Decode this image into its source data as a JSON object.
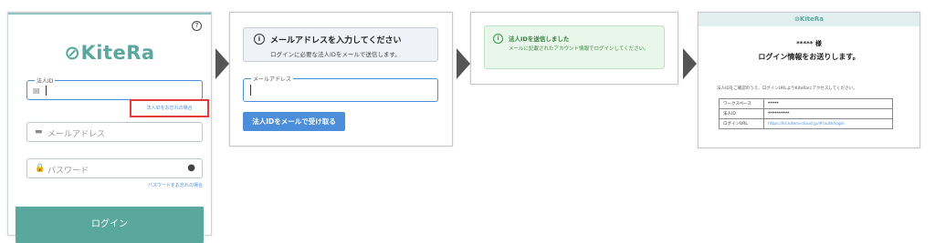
{
  "login": {
    "logo": "KiteRa",
    "help_icon": "?",
    "corporate_id_legend": "法人ID",
    "forgot_corporate_id": "法人IDをお忘れの場合",
    "email_placeholder": "メールアドレス",
    "password_placeholder": "パスワード",
    "forgot_password": "パスワードをお忘れの場合",
    "login_button": "ログイン"
  },
  "request": {
    "info_title": "メールアドレスを入力してください",
    "info_body": "ログインに必要な法人IDをメールで送信します。",
    "email_legend": "メールアドレス",
    "send_button": "法人IDをメールで受け取る"
  },
  "result": {
    "success_title": "法人IDを送信しました",
    "success_body": "メールに記載されたアカウント情報でログインしてください。"
  },
  "email": {
    "header": "KiteRa",
    "recipient": "***** 様",
    "title": "ログイン情報をお送りします。",
    "note": "法人IDをご確認のうえ、ログインURLよりKiteRaにアクセスしてください。",
    "rows": [
      {
        "label": "ワークスペース",
        "value": "*****"
      },
      {
        "label": "法人ID",
        "value": "**********"
      },
      {
        "label": "ログインURL",
        "value": "https://kt.kitera-cloud.jp/#/auth/login"
      }
    ]
  },
  "icons": {
    "building": "▤",
    "mail": "▬",
    "lock": "🔒",
    "eye": "●",
    "info": "i"
  },
  "colors": {
    "brand_teal": "#5aa79d",
    "link_blue": "#4d8edb",
    "highlight_red": "#e23c3c",
    "success_green": "#3d9a4b"
  }
}
